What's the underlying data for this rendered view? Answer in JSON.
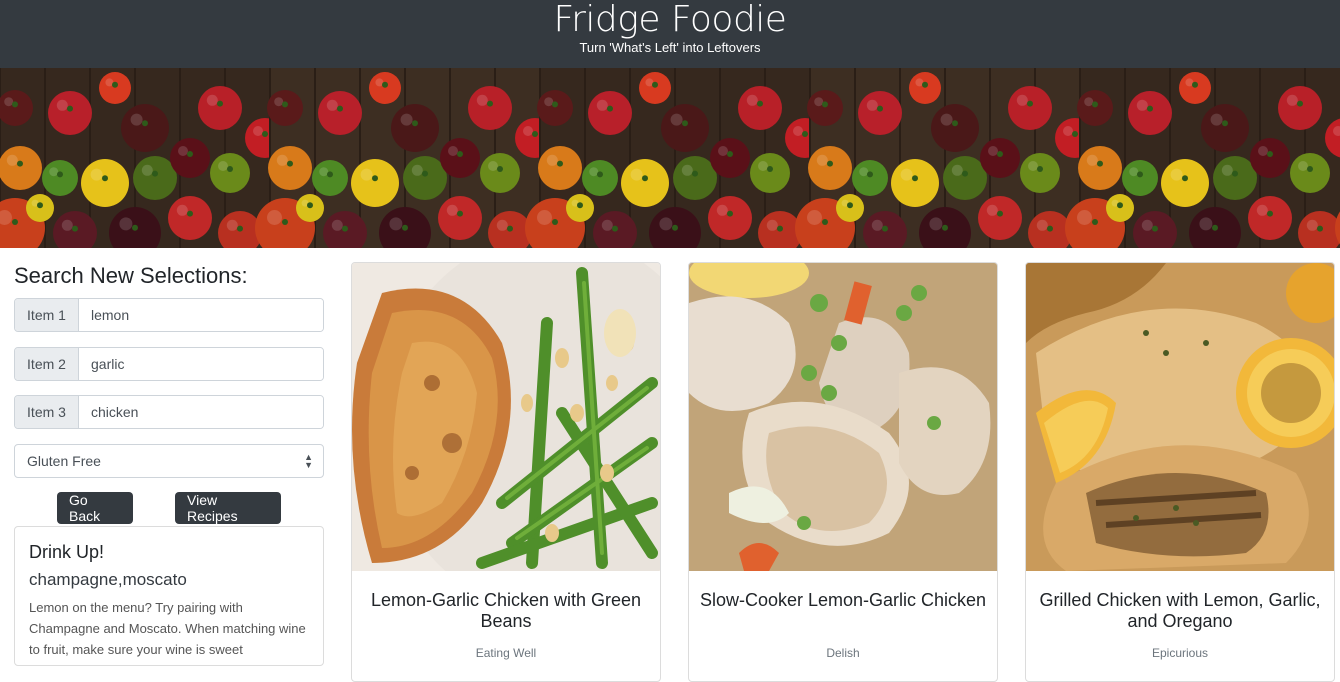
{
  "header": {
    "title": "Fridge Foodie",
    "subtitle": "Turn 'What's Left' into Leftovers"
  },
  "sidebar": {
    "heading": "Search New Selections:",
    "items": [
      {
        "label": "Item 1",
        "value": "lemon"
      },
      {
        "label": "Item 2",
        "value": "garlic"
      },
      {
        "label": "Item 3",
        "value": "chicken"
      }
    ],
    "diet_select": {
      "selected": "Gluten Free"
    },
    "go_back_label": "Go Back",
    "view_recipes_label": "View Recipes"
  },
  "drink": {
    "title": "Drink Up!",
    "wines": "champagne,moscato",
    "text": "Lemon on the menu? Try pairing with Champagne and Moscato. When matching wine to fruit, make sure your wine is sweet"
  },
  "recipes": [
    {
      "title": "Lemon-Garlic Chicken with Green Beans",
      "source": "Eating Well",
      "image_icon": "chicken-green-beans-photo"
    },
    {
      "title": "Slow-Cooker Lemon-Garlic Chicken",
      "source": "Delish",
      "image_icon": "chicken-stew-photo"
    },
    {
      "title": "Grilled Chicken with Lemon, Garlic, and Oregano",
      "source": "Epicurious",
      "image_icon": "grilled-chicken-lemon-photo"
    }
  ],
  "colors": {
    "header_bg": "#343a40",
    "button_bg": "#343a40",
    "addon_bg": "#e9ecef"
  }
}
